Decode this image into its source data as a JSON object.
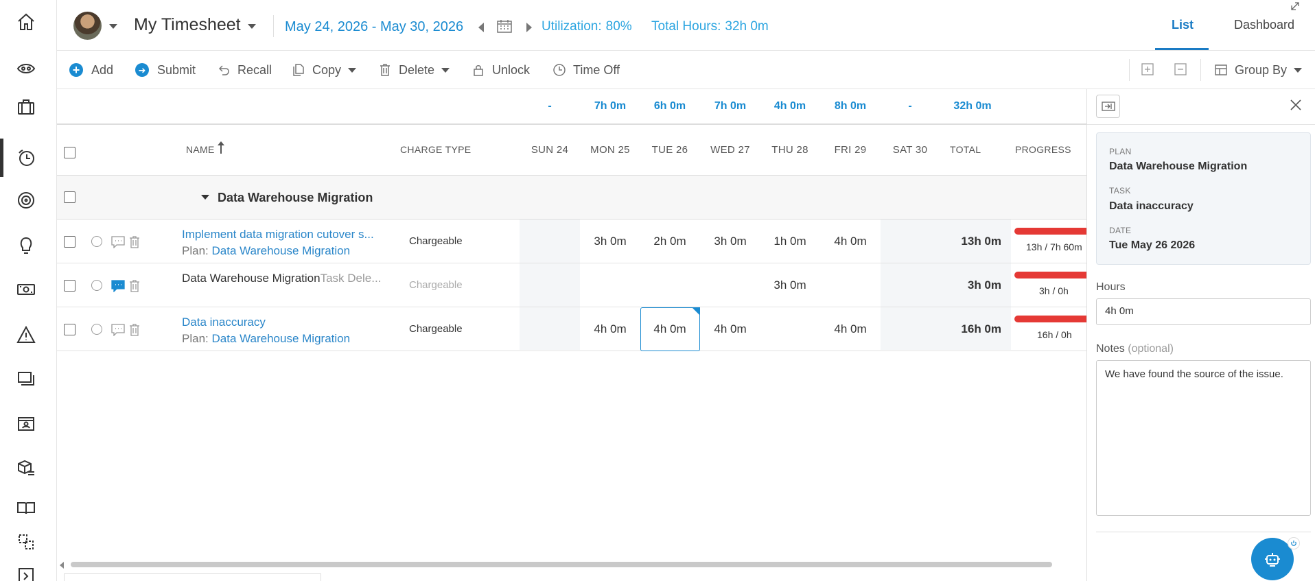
{
  "nav": {
    "items": [
      "home-icon",
      "eye-icon",
      "briefcase-icon",
      "timesheet-icon",
      "target-icon",
      "lightbulb-icon",
      "money-icon",
      "warning-icon",
      "layers-icon",
      "contact-card-icon",
      "package-list-icon",
      "book-icon",
      "dashed-boxes-icon",
      "arrow-box-icon"
    ],
    "active": "timesheet-icon"
  },
  "header": {
    "title": "My Timesheet",
    "date_range": "May 24, 2026 - May 30, 2026",
    "utilization_label": "Utilization:",
    "utilization_value": "80%",
    "total_hours_label": "Total Hours:",
    "total_hours_value": "32h 0m",
    "tabs": {
      "list": "List",
      "dashboard": "Dashboard"
    },
    "active_tab": "List"
  },
  "toolbar": {
    "add": "Add",
    "submit": "Submit",
    "recall": "Recall",
    "copy": "Copy",
    "delete": "Delete",
    "unlock": "Unlock",
    "time_off": "Time Off",
    "group_by": "Group By"
  },
  "grid": {
    "daily_totals": [
      "-",
      "7h 0m",
      "6h 0m",
      "7h 0m",
      "4h 0m",
      "8h 0m",
      "-"
    ],
    "grand_total": "32h 0m",
    "columns": {
      "name": "Name",
      "charge_type": "Charge Type",
      "days": [
        "Sun 24",
        "Mon 25",
        "Tue 26",
        "Wed 27",
        "Thu 28",
        "Fri 29",
        "Sat 30"
      ],
      "total": "Total",
      "progress": "Progress"
    },
    "group": {
      "title": "Data Warehouse Migration"
    },
    "rows": [
      {
        "task": "Implement data migration cutover s...",
        "plan_label": "Plan:",
        "plan": "Data Warehouse Migration",
        "charge_type": "Chargeable",
        "hours": [
          "",
          "3h 0m",
          "2h 0m",
          "3h 0m",
          "1h 0m",
          "4h 0m",
          ""
        ],
        "total": "13h 0m",
        "progress_text": "13h / 7h 60m",
        "progress": 1.0
      },
      {
        "task": "Data Warehouse Migration",
        "task_suffix": "Task Dele...",
        "charge_type": "Chargeable",
        "hours": [
          "",
          "",
          "",
          "",
          "3h 0m",
          "",
          ""
        ],
        "total": "3h 0m",
        "progress_text": "3h / 0h",
        "progress": 1.0
      },
      {
        "task": "Data inaccuracy",
        "plan_label": "Plan:",
        "plan": "Data Warehouse Migration",
        "charge_type": "Chargeable",
        "hours": [
          "",
          "4h 0m",
          "4h 0m",
          "4h 0m",
          "",
          "4h 0m",
          ""
        ],
        "total": "16h 0m",
        "progress_text": "16h / 0h",
        "progress": 1.0
      }
    ]
  },
  "panel": {
    "plan_label": "Plan",
    "plan_value": "Data Warehouse Migration",
    "task_label": "Task",
    "task_value": "Data inaccuracy",
    "date_label": "Date",
    "date_value": "Tue May 26 2026",
    "hours_label": "Hours",
    "hours_value": "4h 0m",
    "notes_label": "Notes",
    "notes_optional": "(optional)",
    "notes_value": "We have found the source of the issue."
  },
  "colors": {
    "accent": "#1a8bd1",
    "progress_over": "#e53935"
  }
}
